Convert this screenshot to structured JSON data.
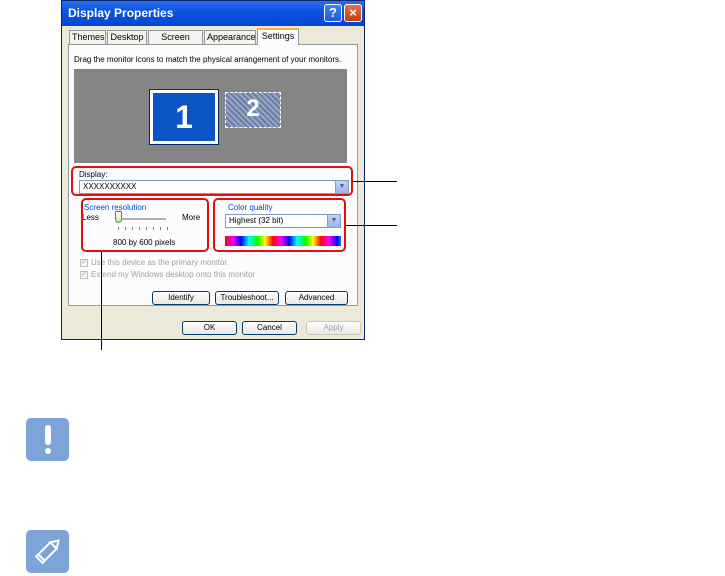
{
  "window": {
    "title": "Display Properties",
    "help_glyph": "?",
    "close_glyph": "×"
  },
  "tabs": [
    {
      "label": "Themes"
    },
    {
      "label": "Desktop"
    },
    {
      "label": "Screen Saver"
    },
    {
      "label": "Appearance"
    },
    {
      "label": "Settings",
      "active": true
    }
  ],
  "settings": {
    "instruction": "Drag the monitor icons to match the physical arrangement of your monitors.",
    "monitors": [
      {
        "label": "1",
        "selected": true
      },
      {
        "label": "2",
        "selected": false
      }
    ],
    "display_label": "Display:",
    "display_value": "XXXXXXXXXX",
    "screen_resolution_label": "Screen resolution",
    "less_label": "Less",
    "more_label": "More",
    "resolution_value": "800 by 600 pixels",
    "resolution_slider_level": 0,
    "color_quality_label": "Color quality",
    "color_quality_value": "Highest (32 bit)",
    "primary_monitor_label": "Use this device as the primary monitor.",
    "extend_desktop_label": "Extend my Windows desktop onto this monitor",
    "check_glyph": "✓",
    "dropdown_glyph": "▼",
    "identify_label": "Identify",
    "troubleshoot_label": "Troubleshoot...",
    "advanced_label": "Advanced"
  },
  "dialog_buttons": {
    "ok": "OK",
    "cancel": "Cancel",
    "apply": "Apply"
  },
  "icons": {
    "caution": "exclamation-icon",
    "note": "pencil-icon"
  },
  "colors": {
    "titlebar": "#0A54E3",
    "dialog_bg": "#ECE9D8",
    "callout": "#E01010",
    "notice_icon": "#7DA4D6"
  }
}
